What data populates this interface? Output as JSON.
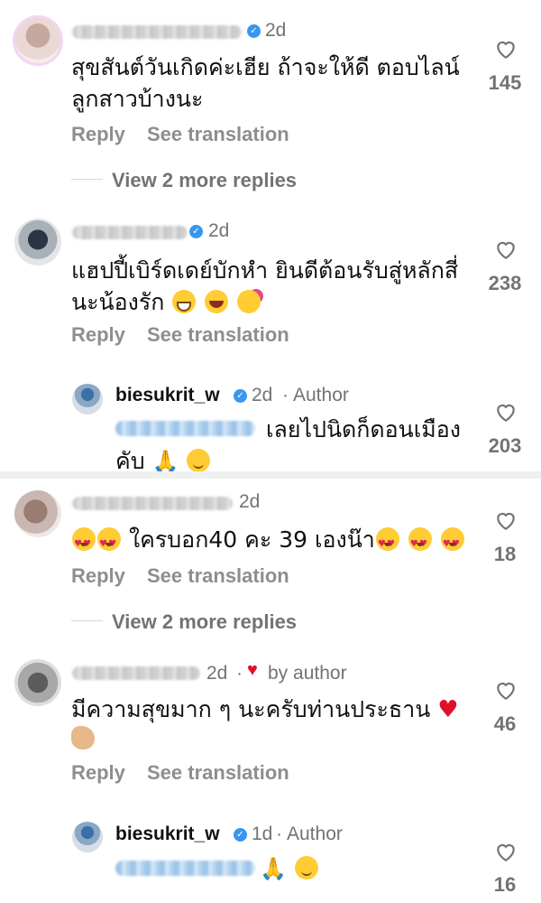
{
  "colors": {
    "verified": "#3797f0",
    "muted": "#737373",
    "action": "#8e8e8e",
    "heart_red": "#e0102b"
  },
  "comments": [
    {
      "time": "2d",
      "text_line1": "สุขสันต์วันเกิดค่ะเฮีย ถ้าจะให้ดี ตอบไลน์",
      "text_line2": "ลูกสาวบ้างนะ",
      "likes": "145",
      "reply": "Reply",
      "translate": "See translation",
      "view_more": "View 2 more replies"
    },
    {
      "time": "2d",
      "text_line1": "แฮปปี้เบิร์ดเดย์บักหำ ยินดีต้อนรับสู่หลักสี่",
      "text_line2": "นะน้องรัก",
      "likes": "238",
      "reply": "Reply",
      "translate": "See translation"
    },
    {
      "time": "2d",
      "text_mid": "ใครบอก40 คะ 39 เองน๊า",
      "likes": "18",
      "reply": "Reply",
      "translate": "See translation",
      "view_more": "View 2 more replies"
    },
    {
      "time": "2d",
      "dot": "·",
      "by_author": "by author",
      "text_line1": "มีความสุขมาก ๆ นะครับท่านประธาน",
      "likes": "46",
      "reply": "Reply",
      "translate": "See translation"
    }
  ],
  "author_replies": [
    {
      "username": "biesukrit_w",
      "time": "2d",
      "dot": "·",
      "role": "Author",
      "text_line1": "เลยไปนิดก็ดอนเมือง",
      "text_line2": "คับ",
      "likes": "203"
    },
    {
      "username": "biesukrit_w",
      "time": "1d",
      "dot": "·",
      "role": "Author",
      "likes": "16"
    }
  ],
  "icons": [
    "heart-outline-icon",
    "verified-badge-icon"
  ]
}
